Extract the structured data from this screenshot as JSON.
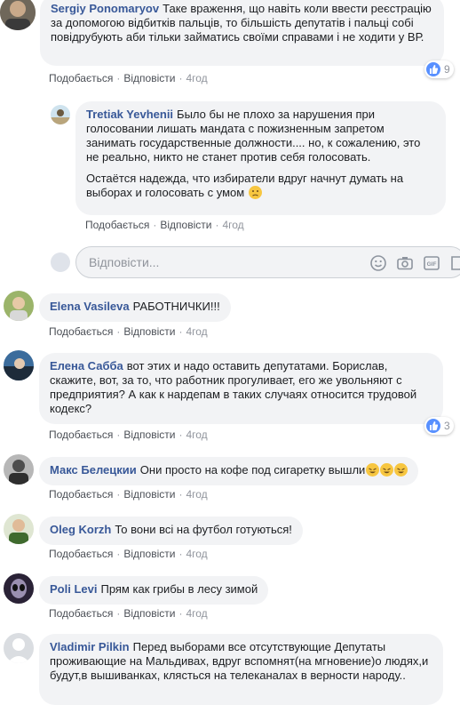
{
  "comments": [
    {
      "author": "Sergiy Ponomaryov",
      "text": "Таке враження, що навіть коли ввести реєстрацію за допомогою відбитків пальців, то більшість депутатів і пальці собі повідрубують аби тільки займатись своїми справами і не ходити у ВР.",
      "actions": {
        "like": "Подобається",
        "reply": "Відповісти",
        "time": "4год"
      },
      "reactions": "9"
    },
    {
      "author": "Tretiak Yevhenii",
      "text": "Было бы не плохо за нарушения при голосовании лишать мандата с пожизненным запретом занимать государственные должности.... но, к сожалению, это не реально, никто не станет против себя голосовать.",
      "text2": "Остаётся надежда, что избиратели вдруг начнут думать на выборах и голосовать с умом",
      "actions": {
        "like": "Подобається",
        "reply": "Відповісти",
        "time": "4год"
      }
    },
    {
      "author": "Elena Vasileva",
      "text": "РАБОТНИЧКИ!!!",
      "actions": {
        "like": "Подобається",
        "reply": "Відповісти",
        "time": "4год"
      }
    },
    {
      "author": "Елена Сабба",
      "text": "вот этих и надо оставить депутатами. Борислав, скажите, вот, за то, что работник прогуливает, его же увольняют с предприятия? А как к нардепам в таких случаях относится трудовой кодекс?",
      "actions": {
        "like": "Подобається",
        "reply": "Відповісти",
        "time": "4год"
      },
      "reactions": "3"
    },
    {
      "author": "Макс Белецкии",
      "text": "Они просто на кофе под сигаретку вышли",
      "actions": {
        "like": "Подобається",
        "reply": "Відповісти",
        "time": "4год"
      }
    },
    {
      "author": "Oleg Korzh",
      "text": "То вони всі на футбол готуються!",
      "actions": {
        "like": "Подобається",
        "reply": "Відповісти",
        "time": "4год"
      }
    },
    {
      "author": "Poli Levi",
      "text": "Прям как грибы в лесу зимой",
      "actions": {
        "like": "Подобається",
        "reply": "Відповісти",
        "time": "4год"
      }
    },
    {
      "author": "Vladimir Pilkin",
      "text": "Перед выборами все отсутствующие Депутаты проживающие на Мальдивах, вдруг вспомнят(на мгновение)о людях,и будут,в вышиванках, клясться на телеканалах в верности народу.."
    }
  ],
  "reply_box": {
    "placeholder": "Відповісти..."
  },
  "colors": {
    "author": "#385898",
    "bubble": "#f2f3f5",
    "like_blue": "#5890ff"
  }
}
